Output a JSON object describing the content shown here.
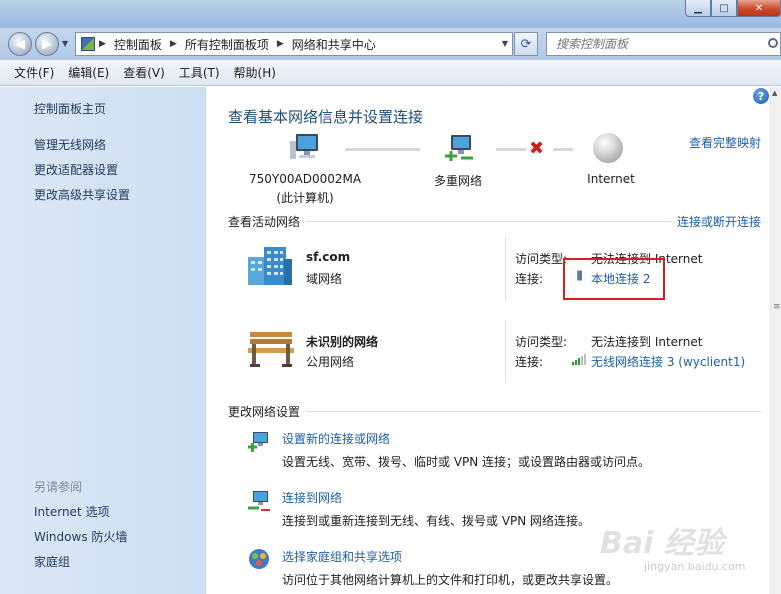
{
  "window": {
    "buttons": {
      "minimize": "▁",
      "maximize": "□",
      "close": "✕"
    }
  },
  "address_bar": {
    "crumbs": [
      "控制面板",
      "所有控制面板项",
      "网络和共享中心"
    ],
    "search_placeholder": "搜索控制面板"
  },
  "menu": {
    "items": [
      "文件(F)",
      "编辑(E)",
      "查看(V)",
      "工具(T)",
      "帮助(H)"
    ]
  },
  "sidebar": {
    "items": [
      "控制面板主页",
      "管理无线网络",
      "更改适配器设置",
      "更改高级共享设置"
    ],
    "see_also_header": "另请参阅",
    "see_also": [
      "Internet 选项",
      "Windows 防火墙",
      "家庭组"
    ]
  },
  "main": {
    "title": "查看基本网络信息并设置连接",
    "full_map_link": "查看完整映射",
    "map": {
      "computer_name": "750Y00AD0002MA",
      "computer_sub": "(此计算机)",
      "middle": "多重网络",
      "internet": "Internet"
    },
    "active_networks": {
      "title": "查看活动网络",
      "connect_link": "连接或断开连接",
      "networks": [
        {
          "name": "sf.com",
          "type": "域网络",
          "access_label": "访问类型:",
          "access_value": "无法连接到 Internet",
          "conn_label": "连接:",
          "conn_value": "本地连接 2"
        },
        {
          "name": "未识别的网络",
          "type": "公用网络",
          "access_label": "访问类型:",
          "access_value": "无法连接到 Internet",
          "conn_label": "连接:",
          "conn_value": "无线网络连接 3 (wyclient1)"
        }
      ]
    },
    "change_settings": {
      "title": "更改网络设置",
      "tasks": [
        {
          "link": "设置新的连接或网络",
          "desc": "设置无线、宽带、拨号、临时或 VPN 连接；或设置路由器或访问点。"
        },
        {
          "link": "连接到网络",
          "desc": "连接到或重新连接到无线、有线、拨号或 VPN 网络连接。"
        },
        {
          "link": "选择家庭组和共享选项",
          "desc": "访问位于其他网络计算机上的文件和打印机，或更改共享设置。"
        }
      ]
    },
    "help": "?"
  },
  "watermark": {
    "text": "Bai 经验",
    "sub": "jingyan.baidu.com"
  },
  "colors": {
    "link": "#1e5fa8",
    "title": "#1e4e79",
    "highlight": "#d32020",
    "sidebar_bg": "#d5e4f5"
  }
}
